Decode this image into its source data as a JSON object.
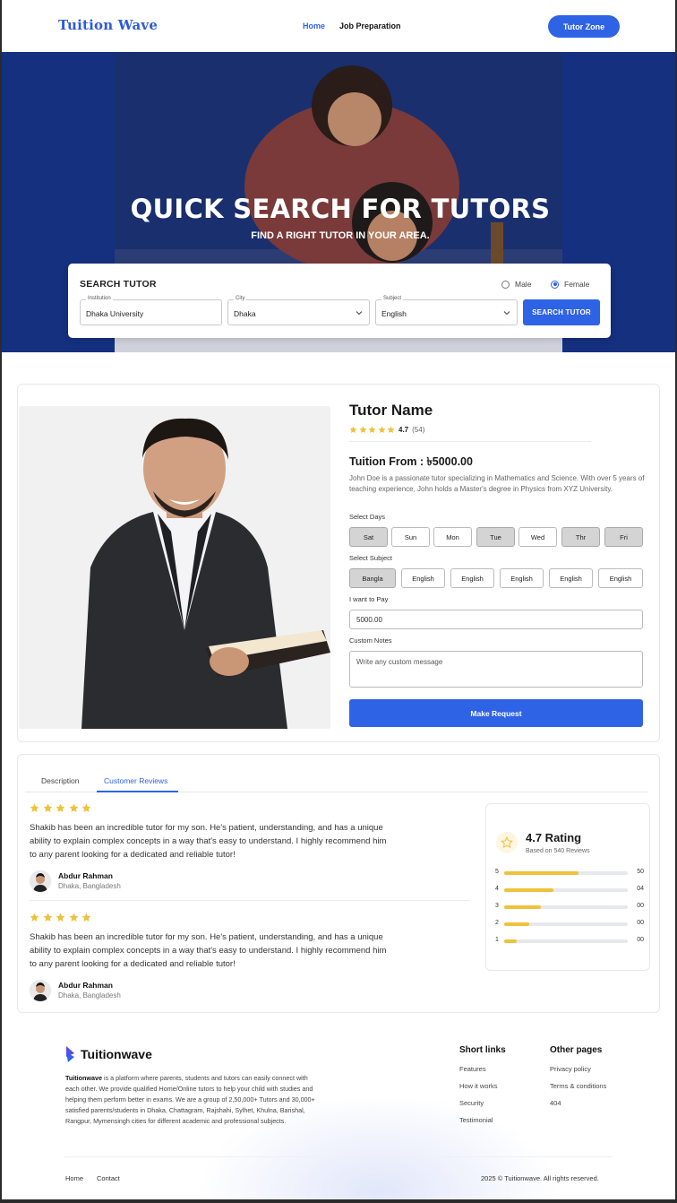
{
  "header": {
    "logo": "Tuition Wave",
    "nav": [
      {
        "label": "Home"
      },
      {
        "label": "Job Preparation"
      }
    ],
    "tutor_zone_label": "Tutor Zone"
  },
  "hero": {
    "title": "QUICK SEARCH FOR TUTORS",
    "subtitle": "FIND A RIGHT TUTOR IN YOUR AREA."
  },
  "search": {
    "title": "SEARCH TUTOR",
    "gender": {
      "options": [
        "Male",
        "Female"
      ],
      "selected": "Female"
    },
    "institution": {
      "label": "Institution",
      "value": "Dhaka University"
    },
    "city": {
      "label": "City",
      "value": "Dhaka"
    },
    "subject": {
      "label": "Subject",
      "value": "English"
    },
    "button_label": "SEARCH TUTOR"
  },
  "tutor": {
    "name": "Tutor Name",
    "rating": "4.7",
    "rating_count": "(54)",
    "stars": 5,
    "price": "Tuition From : ৳5000.00",
    "description": "John Doe is a passionate tutor specializing in Mathematics and Science. With over 5 years of teaching experience, John holds a Master's degree in Physics from XYZ University.",
    "days_label": "Select Days",
    "days": [
      {
        "label": "Sat",
        "selected": true
      },
      {
        "label": "Sun",
        "selected": false
      },
      {
        "label": "Mon",
        "selected": false
      },
      {
        "label": "Tue",
        "selected": true
      },
      {
        "label": "Wed",
        "selected": false
      },
      {
        "label": "Thr",
        "selected": true
      },
      {
        "label": "Fri",
        "selected": true
      }
    ],
    "subject_label": "Select Subject",
    "subjects": [
      {
        "label": "Bangla",
        "selected": true
      },
      {
        "label": "English",
        "selected": false
      },
      {
        "label": "English",
        "selected": false
      },
      {
        "label": "English",
        "selected": false
      },
      {
        "label": "English",
        "selected": false
      },
      {
        "label": "English",
        "selected": false
      }
    ],
    "pay_label": "I want to Pay",
    "pay_value": "5000.00",
    "notes_label": "Custom Notes",
    "notes_placeholder": "Write any custom message",
    "request_label": "Make Request"
  },
  "reviews": {
    "tabs": [
      {
        "label": "Description"
      },
      {
        "label": "Customer Reviews"
      }
    ],
    "active_tab": "Customer Reviews",
    "items": [
      {
        "stars": 5,
        "text": "Shakib has been an incredible tutor for my son. He's patient, understanding, and has a unique ability to explain complex concepts in a way that's easy to understand.  I highly recommend him to any parent looking for a dedicated and reliable tutor!",
        "author": "Abdur Rahman",
        "location": "Dhaka, Bangladesh"
      },
      {
        "stars": 5,
        "text": "Shakib has been an incredible tutor for my son. He's patient, understanding, and has a unique ability to explain complex concepts in a way that's easy to understand.  I highly recommend him to any parent looking for a dedicated and reliable tutor!",
        "author": "Abdur Rahman",
        "location": "Dhaka, Bangladesh"
      }
    ],
    "summary": {
      "title": "4.7 Rating",
      "subtitle": "Based on 540 Reviews",
      "bars": [
        {
          "label": "5",
          "count": "50",
          "fill": 0.6
        },
        {
          "label": "4",
          "count": "04",
          "fill": 0.4
        },
        {
          "label": "3",
          "count": "00",
          "fill": 0.3
        },
        {
          "label": "2",
          "count": "00",
          "fill": 0.2
        },
        {
          "label": "1",
          "count": "00",
          "fill": 0.1
        }
      ]
    }
  },
  "footer": {
    "logo": "Tuitionwave",
    "description_brand": "Tuitionwave",
    "description": " is a platform where parents, students and tutors can easily connect with each other. We provide qualified Home/Online tutors to help your child with studies and helping them perform better in exams. We are a group of 2,50,000+ Tutors and 30,000+ satisfied parents/students in Dhaka, Chattagram, Rajshahi, Sylhet, Khulna, Barishal, Rangpur, Mymensingh cities for different academic and professional subjects.",
    "short_links_title": "Short links",
    "short_links": [
      "Features",
      "How it works",
      "Security",
      "Testimonial"
    ],
    "other_pages_title": "Other pages",
    "other_pages": [
      "Privacy policy",
      "Terms & conditions",
      "404"
    ],
    "bottom_links": [
      "Home",
      "Contact"
    ],
    "copyright": "2025 © Tuitionwave. All rights reserved."
  },
  "colors": {
    "accent": "#2f63e6",
    "hero_bg": "#14307f",
    "star": "#efc23d"
  }
}
